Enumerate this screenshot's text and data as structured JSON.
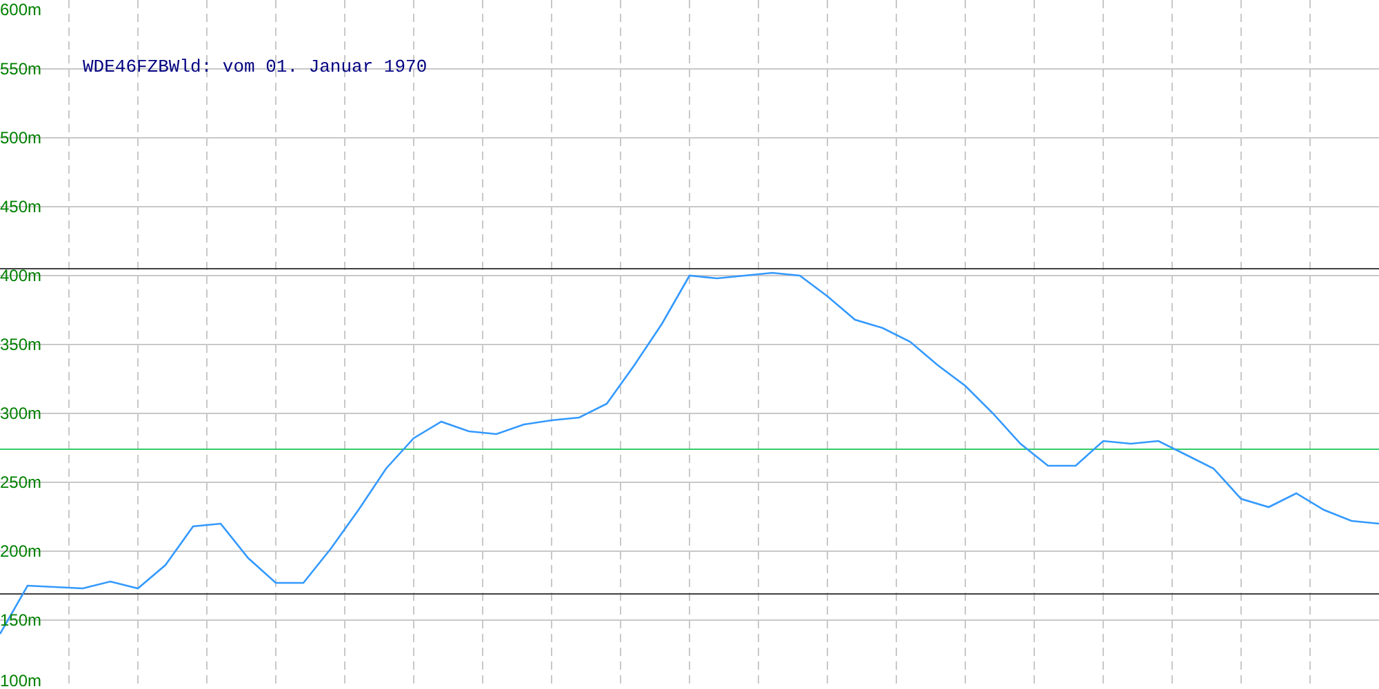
{
  "chart_data": {
    "type": "line",
    "title": "WDE46FZBWld: vom 01. Januar 1970",
    "ylim": [
      100,
      600
    ],
    "yticks": [
      {
        "value": 600,
        "label": "600m"
      },
      {
        "value": 550,
        "label": "550m"
      },
      {
        "value": 500,
        "label": "500m"
      },
      {
        "value": 450,
        "label": "450m"
      },
      {
        "value": 400,
        "label": "400m"
      },
      {
        "value": 350,
        "label": "350m"
      },
      {
        "value": 300,
        "label": "300m"
      },
      {
        "value": 250,
        "label": "250m"
      },
      {
        "value": 200,
        "label": "200m"
      },
      {
        "value": 150,
        "label": "150m"
      },
      {
        "value": 100,
        "label": "100m"
      }
    ],
    "categories": [
      null,
      null,
      null,
      null,
      null,
      null,
      null,
      null,
      null,
      null,
      null,
      null,
      null,
      null,
      null,
      null,
      null,
      null,
      null,
      null,
      null,
      null,
      null,
      null,
      null,
      null,
      null,
      null,
      null,
      null,
      null,
      null,
      null,
      null,
      null,
      null,
      null,
      null,
      null,
      null,
      null,
      null,
      null,
      null,
      null,
      null,
      null,
      null,
      null,
      null,
      null
    ],
    "series": [
      {
        "color": "#3399ff",
        "values": [
          140,
          175,
          174,
          173,
          178,
          173,
          190,
          218,
          220,
          195,
          177,
          177,
          202,
          230,
          260,
          282,
          294,
          287,
          285,
          292,
          295,
          297,
          307,
          335,
          365,
          400,
          398,
          400,
          402,
          400,
          385,
          368,
          362,
          352,
          335,
          320,
          300,
          278,
          262,
          262,
          280,
          278,
          280,
          270,
          260,
          238,
          232,
          242,
          230,
          222,
          220
        ]
      }
    ],
    "grid": true,
    "ref_lines": [
      {
        "axis": "y",
        "value": 405,
        "color": "#404040"
      },
      {
        "axis": "y",
        "value": 274,
        "color": "#33cc66"
      },
      {
        "axis": "y",
        "value": 169,
        "color": "#404040"
      }
    ]
  }
}
